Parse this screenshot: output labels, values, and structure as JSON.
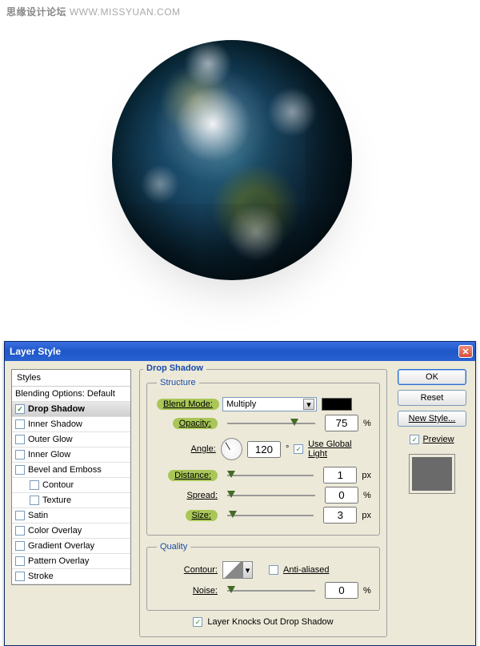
{
  "watermark": {
    "cn": "思缘设计论坛",
    "en": "WWW.MISSYUAN.COM"
  },
  "dialog": {
    "title": "Layer Style",
    "section_title": "Drop Shadow",
    "styles_header": "Styles",
    "styles": [
      {
        "label": "Blending Options: Default",
        "checked": null
      },
      {
        "label": "Drop Shadow",
        "checked": true,
        "active": true
      },
      {
        "label": "Inner Shadow",
        "checked": false
      },
      {
        "label": "Outer Glow",
        "checked": false
      },
      {
        "label": "Inner Glow",
        "checked": false
      },
      {
        "label": "Bevel and Emboss",
        "checked": false
      },
      {
        "label": "Contour",
        "checked": false,
        "indent": 1
      },
      {
        "label": "Texture",
        "checked": false,
        "indent": 1
      },
      {
        "label": "Satin",
        "checked": false
      },
      {
        "label": "Color Overlay",
        "checked": false
      },
      {
        "label": "Gradient Overlay",
        "checked": false
      },
      {
        "label": "Pattern Overlay",
        "checked": false
      },
      {
        "label": "Stroke",
        "checked": false
      }
    ],
    "structure": {
      "legend": "Structure",
      "blend_mode_label": "Blend Mode:",
      "blend_mode_value": "Multiply",
      "opacity_label": "Opacity:",
      "opacity_value": "75",
      "opacity_unit": "%",
      "angle_label": "Angle:",
      "angle_value": "120",
      "angle_unit": "°",
      "global_light_label": "Use Global Light",
      "global_light_checked": true,
      "distance_label": "Distance:",
      "distance_value": "1",
      "distance_unit": "px",
      "spread_label": "Spread:",
      "spread_value": "0",
      "spread_unit": "%",
      "size_label": "Size:",
      "size_value": "3",
      "size_unit": "px"
    },
    "quality": {
      "legend": "Quality",
      "contour_label": "Contour:",
      "antialiased_label": "Anti-aliased",
      "antialiased_checked": false,
      "noise_label": "Noise:",
      "noise_value": "0",
      "noise_unit": "%"
    },
    "knockout": {
      "label": "Layer Knocks Out Drop Shadow",
      "checked": true
    },
    "buttons": {
      "ok": "OK",
      "reset": "Reset",
      "new_style": "New Style...",
      "preview_label": "Preview",
      "preview_checked": true
    }
  }
}
